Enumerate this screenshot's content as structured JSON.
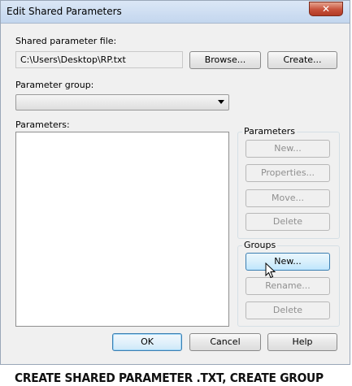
{
  "window": {
    "title": "Edit Shared Parameters",
    "close_glyph": "✕"
  },
  "shared_file": {
    "label": "Shared parameter file:",
    "path": "C:\\Users\\Desktop\\RP.txt",
    "browse_label": "Browse...",
    "create_label": "Create..."
  },
  "parameter_group": {
    "label": "Parameter group:",
    "selected": ""
  },
  "parameters_list": {
    "label": "Parameters:",
    "items": []
  },
  "parameters_box": {
    "caption": "Parameters",
    "new_label": "New...",
    "properties_label": "Properties...",
    "move_label": "Move...",
    "delete_label": "Delete"
  },
  "groups_box": {
    "caption": "Groups",
    "new_label": "New...",
    "rename_label": "Rename...",
    "delete_label": "Delete"
  },
  "footer_buttons": {
    "ok_label": "OK",
    "cancel_label": "Cancel",
    "help_label": "Help"
  },
  "caption_text": "CREATE SHARED PARAMETER .TXT, CREATE GROUP"
}
